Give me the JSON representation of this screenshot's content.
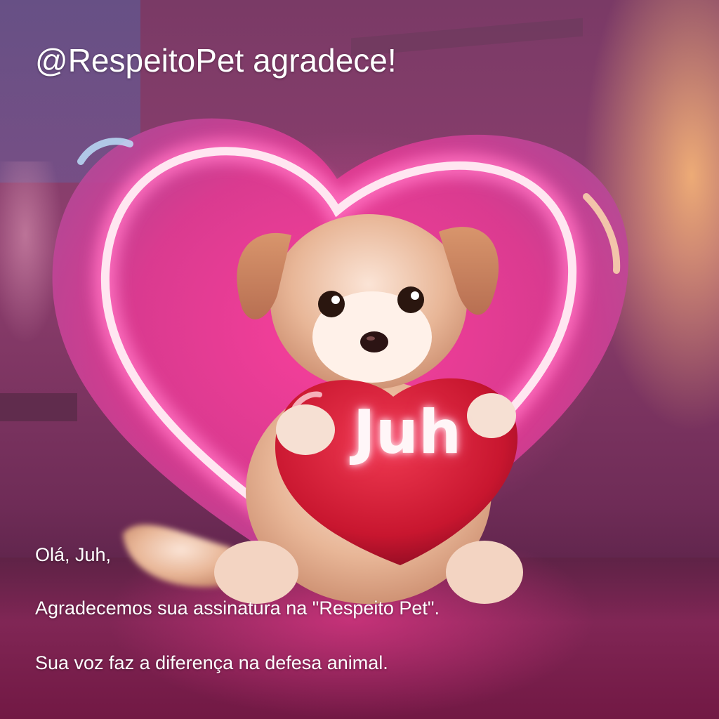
{
  "header": {
    "title": "@RespeitoPet agradece!"
  },
  "message": {
    "greeting": "Olá,  Juh,",
    "line1": "Agradecemos sua assinatura na \"Respeito Pet\".",
    "line2": "Sua voz faz a diferença na defesa animal."
  },
  "illustration": {
    "heart_name": "Juh",
    "colors": {
      "neon_heart": "#ff4fa8",
      "small_heart": "#d4183a",
      "puppy_fur": "#e9b89a"
    }
  }
}
